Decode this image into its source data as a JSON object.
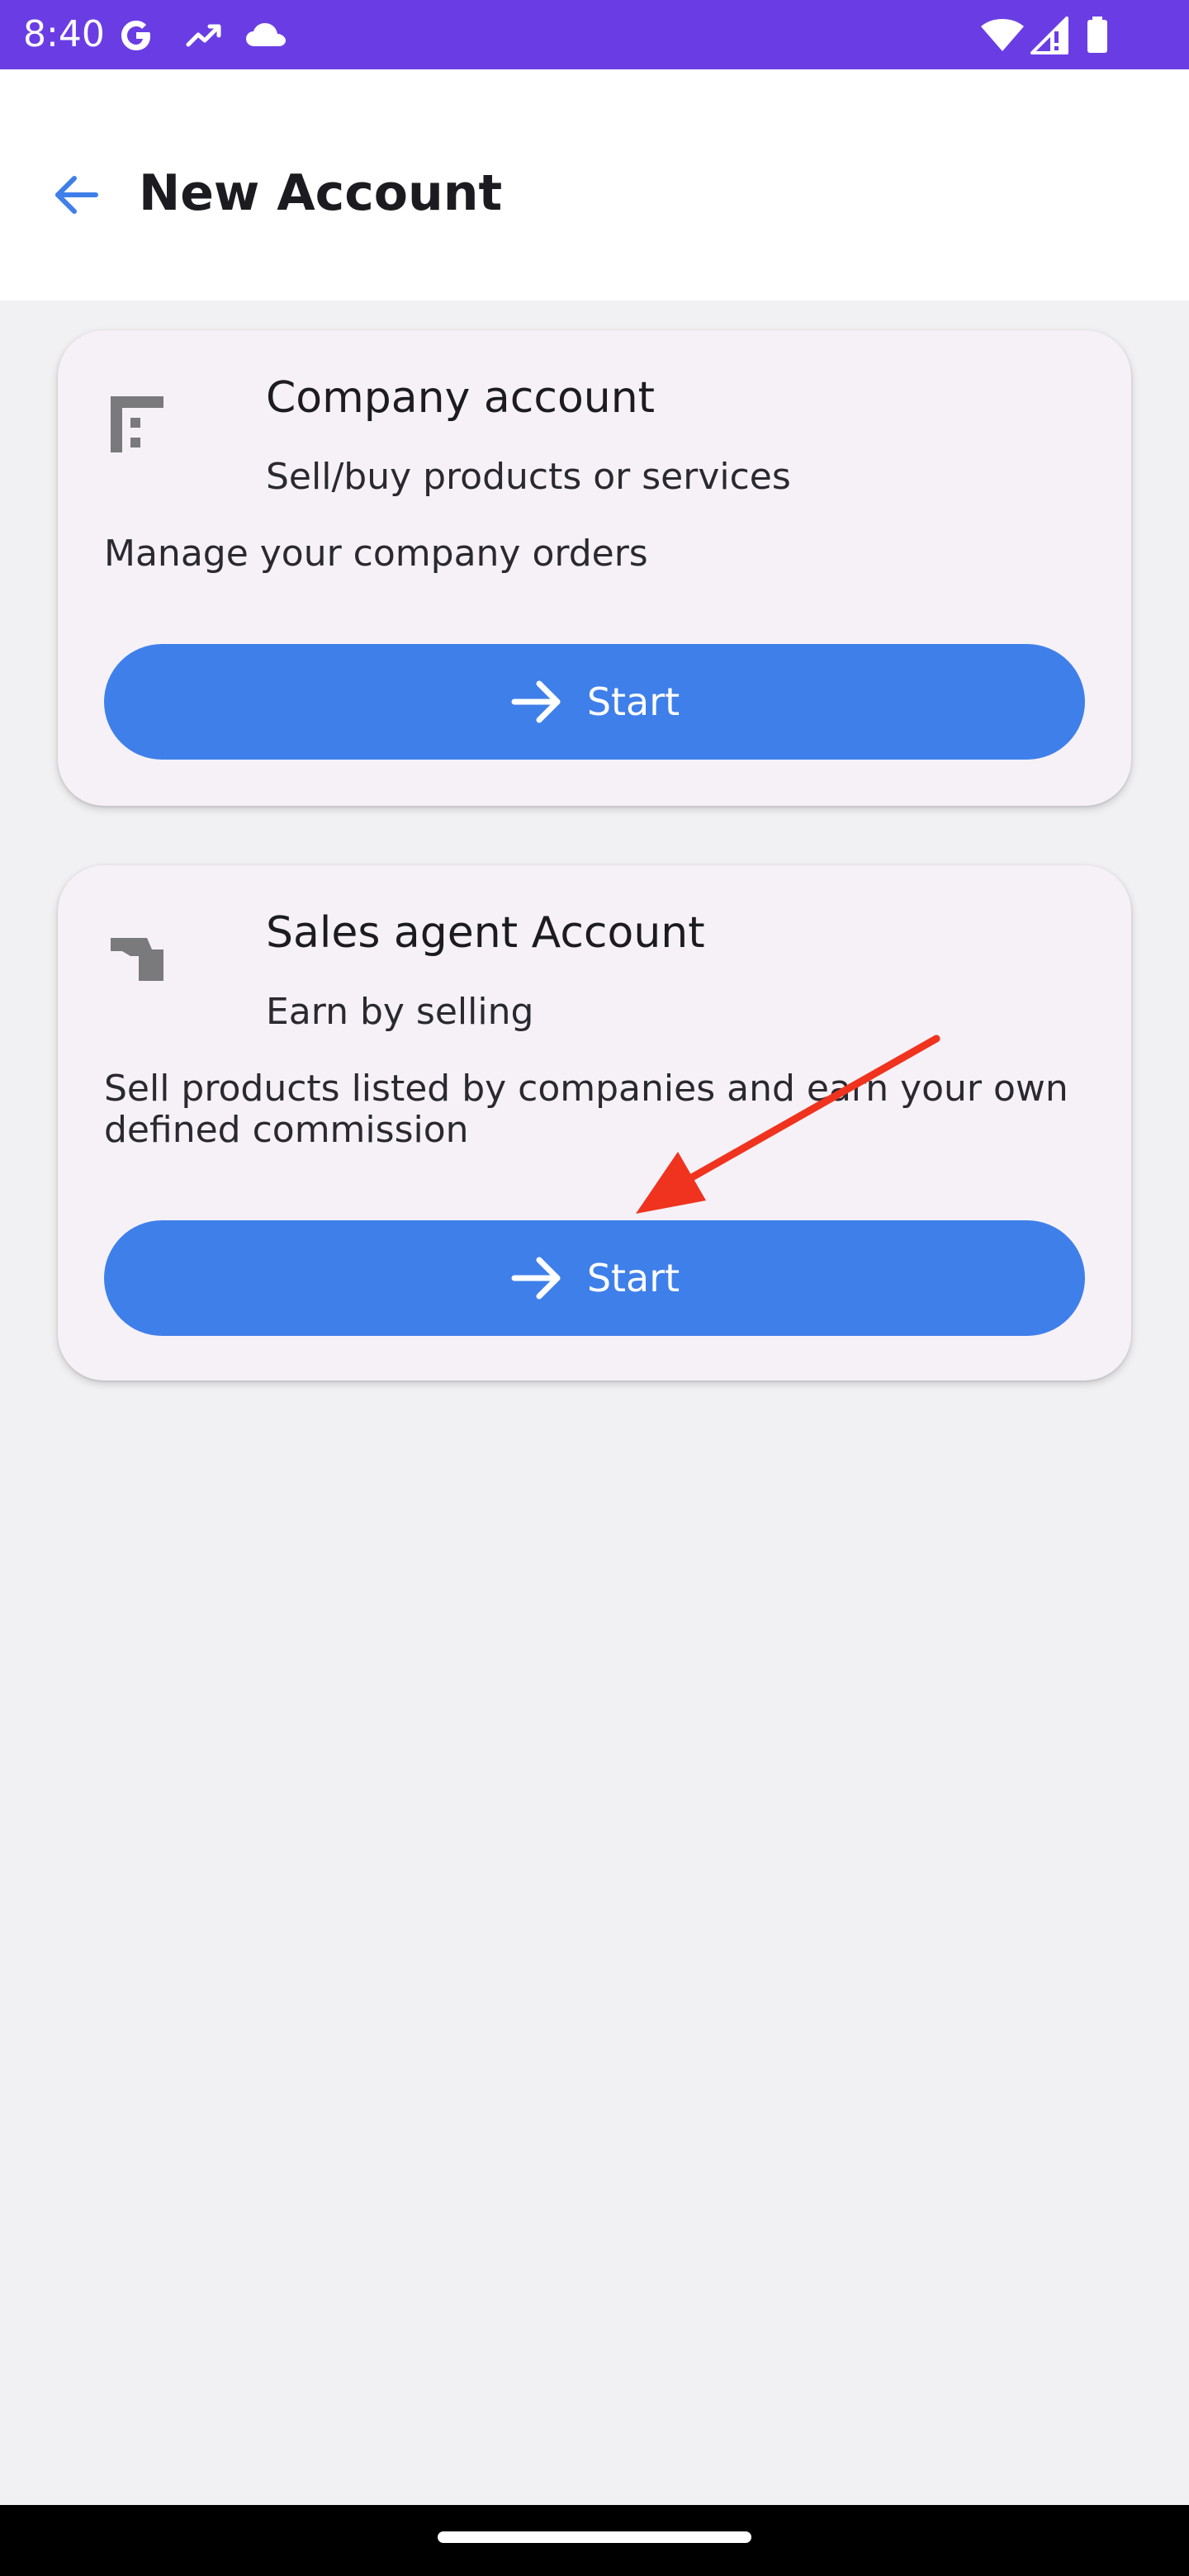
{
  "status_bar": {
    "time": "8:40",
    "icons": [
      "google-g-icon",
      "trending-up-icon",
      "cloud-icon",
      "wifi-icon",
      "cellular-signal-icon",
      "battery-icon"
    ],
    "background_color": "#6a3de4"
  },
  "app_bar": {
    "title": "New Account",
    "back_icon": "arrow-left-icon",
    "accent_color": "#3f7fea"
  },
  "cards": [
    {
      "icon": "building-icon",
      "title": "Company account",
      "subtitle": "Sell/buy products or services",
      "description": "Manage your company orders",
      "button": {
        "label": "Start",
        "icon": "arrow-right-icon"
      }
    },
    {
      "icon": "agent-badge-icon",
      "title": "Sales agent Account",
      "subtitle": "Earn by selling",
      "description": "Sell products listed by companies and earn your own defined commission",
      "button": {
        "label": "Start",
        "icon": "arrow-right-icon"
      }
    }
  ],
  "colors": {
    "button": "#3f7fea",
    "card_background": "#f5f1f7",
    "page_background": "#f1f0f2",
    "annotation_arrow": "#f0331e",
    "icon_gray": "#7a797c"
  }
}
